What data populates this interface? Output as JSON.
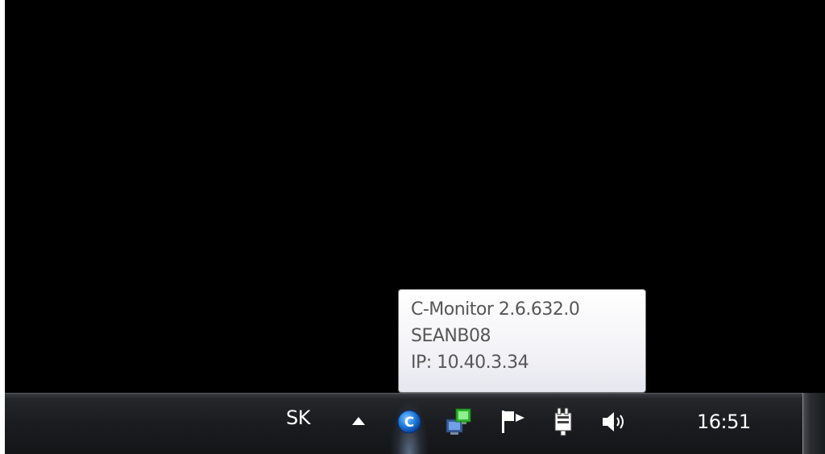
{
  "tooltip": {
    "line1": "C-Monitor 2.6.632.0",
    "line2": "SEANB08",
    "line3": "IP: 10.40.3.34"
  },
  "taskbar": {
    "language": "SK",
    "clock": "16:51"
  },
  "icons": {
    "show_hidden": "arrow-up-icon",
    "cmonitor": "c-monitor-icon",
    "network": "network-icon",
    "action_center": "flag-icon",
    "power": "power-plug-icon",
    "volume": "speaker-icon"
  },
  "colors": {
    "cmonitor_blue": "#1f7fe0",
    "network_green": "#3cc83c"
  }
}
